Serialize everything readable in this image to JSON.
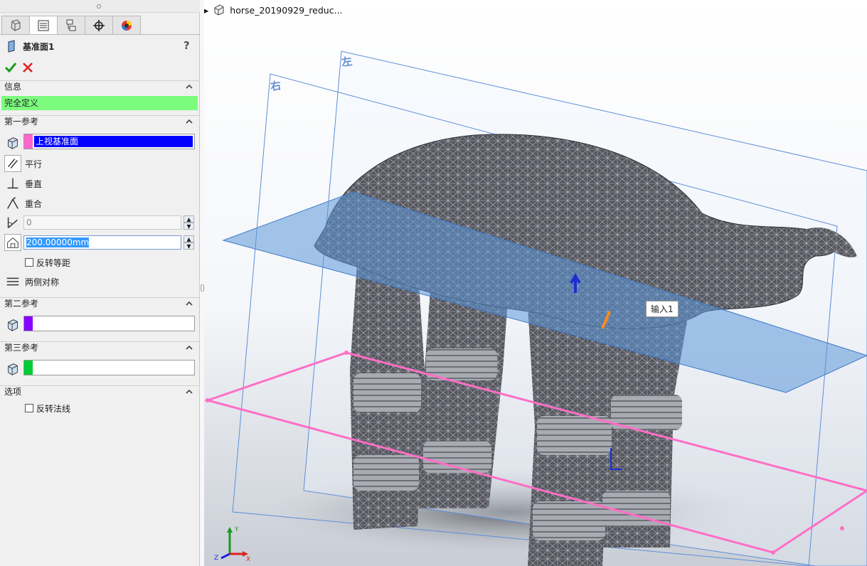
{
  "panel": {
    "feature_title": "基准面1",
    "help": "?",
    "sections": {
      "info": {
        "title": "信息",
        "status": "完全定义"
      },
      "first_ref": {
        "title": "第一参考",
        "selection": "上视基准面",
        "swatch_color": "#ff66cc",
        "options": {
          "parallel": "平行",
          "perpendicular": "垂直",
          "coincident": "重合"
        },
        "angle_value": "0",
        "distance_value": "200.00000mm",
        "flip_offset": "反转等距",
        "mid_plane": "两侧对称"
      },
      "second_ref": {
        "title": "第二参考",
        "swatch_color": "#8800ff"
      },
      "third_ref": {
        "title": "第三参考",
        "swatch_color": "#00cc33"
      },
      "options": {
        "title": "选项",
        "flip_normal": "反转法线"
      }
    }
  },
  "viewport": {
    "tree_root": "horse_20190929_reduc...",
    "callout": "输入1",
    "plane_labels": {
      "left": "左",
      "right": "右"
    },
    "triad": {
      "x": "X",
      "y": "Y",
      "z": "Z"
    }
  },
  "colors": {
    "status_green": "#7cfc7c",
    "selection_blue": "#0000ff",
    "plane_blue": "#4a90d9",
    "preview_pink": "#ff66c4",
    "mesh_body": "#5a5a62"
  }
}
